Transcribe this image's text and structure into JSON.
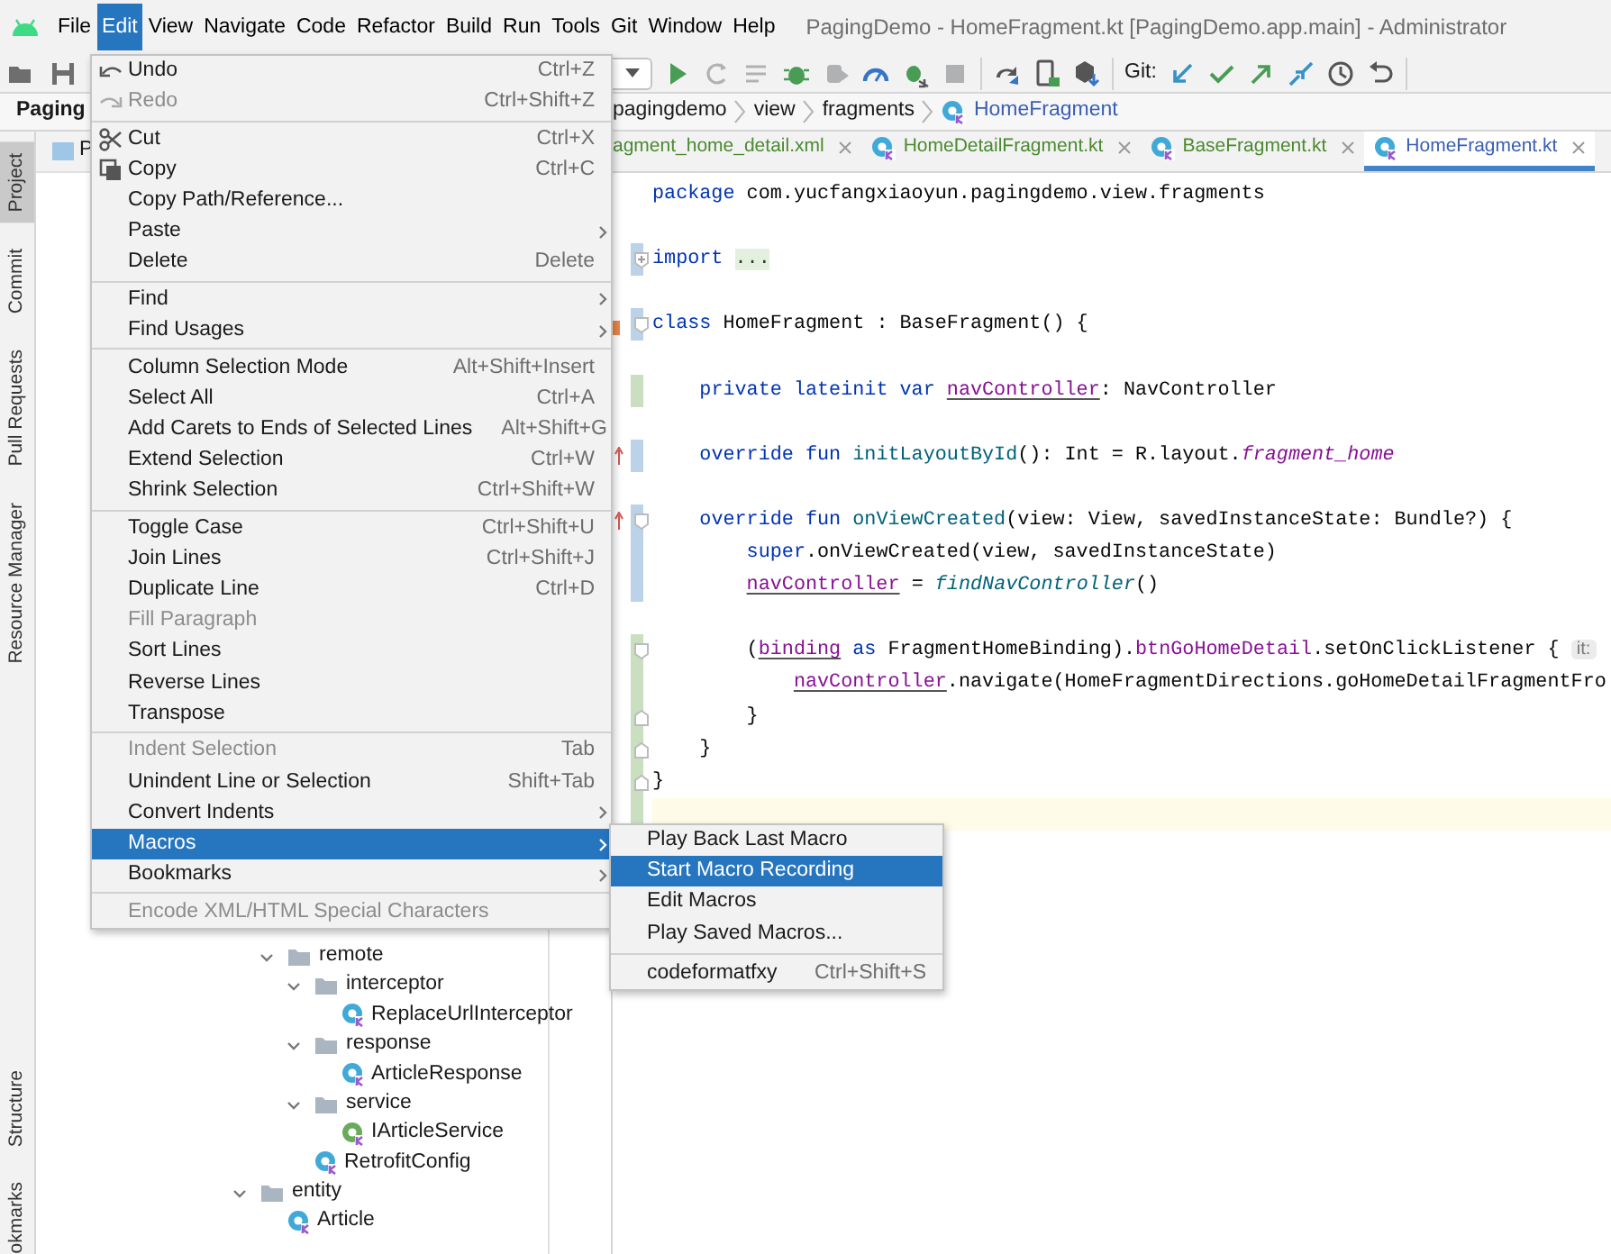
{
  "menubar": {
    "items": [
      {
        "label": "File",
        "selected": false
      },
      {
        "label": "Edit",
        "selected": true
      },
      {
        "label": "View",
        "selected": false
      },
      {
        "label": "Navigate",
        "selected": false
      },
      {
        "label": "Code",
        "selected": false
      },
      {
        "label": "Refactor",
        "selected": false
      },
      {
        "label": "Build",
        "selected": false
      },
      {
        "label": "Run",
        "selected": false
      },
      {
        "label": "Tools",
        "selected": false
      },
      {
        "label": "Git",
        "selected": false
      },
      {
        "label": "Window",
        "selected": false
      },
      {
        "label": "Help",
        "selected": false
      }
    ],
    "window_title": "PagingDemo - HomeFragment.kt [PagingDemo.app.main] - Administrator"
  },
  "toolbar": {
    "git_label": "Git:"
  },
  "breadcrumb": {
    "project": "Paging",
    "items": [
      {
        "label": "pagingdemo",
        "kind": "package"
      },
      {
        "label": "view",
        "kind": "package"
      },
      {
        "label": "fragments",
        "kind": "package"
      },
      {
        "label": "HomeFragment",
        "kind": "class"
      }
    ]
  },
  "tool_stripe": {
    "top": [
      {
        "label": "Project",
        "selected": true
      },
      {
        "label": "Commit",
        "selected": false
      },
      {
        "label": "Pull Requests",
        "selected": false
      },
      {
        "label": "Resource Manager",
        "selected": false
      }
    ],
    "bottom": [
      {
        "label": "Structure",
        "selected": false
      },
      {
        "label": "okmarks",
        "selected": false
      }
    ]
  },
  "project_panel": {
    "header": "P",
    "tree": [
      {
        "children": [
          {
            "label": "remote",
            "kind": "folder",
            "expanded": true,
            "children": [
              {
                "label": "interceptor",
                "kind": "folder",
                "expanded": true,
                "children": [
                  {
                    "label": "ReplaceUrlInterceptor",
                    "kind": "class"
                  }
                ]
              },
              {
                "label": "response",
                "kind": "folder",
                "expanded": true,
                "children": [
                  {
                    "label": "ArticleResponse",
                    "kind": "class"
                  }
                ]
              },
              {
                "label": "service",
                "kind": "folder",
                "expanded": true,
                "children": [
                  {
                    "label": "IArticleService",
                    "kind": "interface"
                  }
                ]
              },
              {
                "label": "RetrofitConfig",
                "kind": "class"
              }
            ]
          }
        ]
      },
      {
        "label": "entity",
        "kind": "folder",
        "expanded": true,
        "children": [
          {
            "label": "Article",
            "kind": "class"
          }
        ]
      }
    ]
  },
  "editor_tabs": [
    {
      "label": "agment_home_detail.xml",
      "modified": false,
      "selected": false
    },
    {
      "label": "HomeDetailFragment.kt",
      "kind": "class",
      "modified": false,
      "selected": false
    },
    {
      "label": "BaseFragment.kt",
      "kind": "class",
      "modified": false,
      "selected": false
    },
    {
      "label": "HomeFragment.kt",
      "kind": "class",
      "modified": true,
      "selected": true
    }
  ],
  "code_lines": [
    {
      "tokens": [
        {
          "kind": "keyword",
          "t": "package"
        },
        {
          "kind": "plain",
          "t": " com.yucfangxiaoyun.pagingdemo.view.fragments"
        }
      ]
    },
    {
      "current": false
    },
    {
      "modified": true,
      "folded": true,
      "tokens": [
        {
          "kind": "keyword",
          "t": "import "
        },
        {
          "kind": "placeholder",
          "t": "..."
        }
      ]
    },
    {
      "current": false
    },
    {
      "modified": true,
      "fold_start": true,
      "implemented": true,
      "tokens": [
        {
          "kind": "keyword",
          "t": "class"
        },
        {
          "kind": "plain",
          "t": " HomeFragment : BaseFragment() {"
        }
      ]
    },
    {
      "current": false
    },
    {
      "added": true,
      "tokens": [
        {
          "kind": "keyword",
          "t": "    private lateinit var "
        },
        {
          "kind": "property",
          "t": "navController"
        },
        {
          "kind": "plain",
          "t": ": NavController"
        }
      ]
    },
    {
      "current": false
    },
    {
      "modified": true,
      "overrides": true,
      "tokens": [
        {
          "kind": "keyword",
          "t": "    override fun "
        },
        {
          "kind": "function",
          "t": "initLayoutById"
        },
        {
          "kind": "plain",
          "t": "(): Int = R.layout."
        },
        {
          "kind": "resource",
          "t": "fragment_home"
        }
      ]
    },
    {
      "current": false
    },
    {
      "modified": true,
      "fold_start": true,
      "overrides": true,
      "tokens": [
        {
          "kind": "keyword",
          "t": "    override fun "
        },
        {
          "kind": "function",
          "t": "onViewCreated"
        },
        {
          "kind": "plain",
          "t": "(view: View, savedInstanceState: Bundle?) {"
        }
      ]
    },
    {
      "modified": true,
      "tokens": [
        {
          "kind": "keyword",
          "t": "        super"
        },
        {
          "kind": "plain",
          "t": ".onViewCreated(view, savedInstanceState)"
        }
      ]
    },
    {
      "modified": true,
      "tokens": [
        {
          "kind": "property",
          "t": "        navController"
        },
        {
          "kind": "plain",
          "t": " = "
        },
        {
          "kind": "extension",
          "t": "findNavController"
        },
        {
          "kind": "plain",
          "t": "()"
        }
      ]
    },
    {
      "current": false
    },
    {
      "added": true,
      "fold_start": true,
      "tokens": [
        {
          "kind": "plain",
          "t": "        ("
        },
        {
          "kind": "property",
          "t": "binding"
        },
        {
          "kind": "keyword",
          "t": " as"
        },
        {
          "kind": "plain",
          "t": " FragmentHomeBinding)."
        },
        {
          "kind": "field",
          "t": "btnGoHomeDetail"
        },
        {
          "kind": "plain",
          "t": ".setOnClickListener { "
        },
        {
          "kind": "hint",
          "t": "it:"
        }
      ]
    },
    {
      "added": true,
      "tokens": [
        {
          "kind": "property",
          "t": "            navController"
        },
        {
          "kind": "plain",
          "t": ".navigate(HomeFragmentDirections.goHomeDetailFragmentFro"
        }
      ]
    },
    {
      "added": true,
      "fold_end": true,
      "tokens": [
        {
          "kind": "plain",
          "t": "        }"
        }
      ]
    },
    {
      "added": true,
      "fold_end": true,
      "tokens": [
        {
          "kind": "plain",
          "t": "    }"
        }
      ]
    },
    {
      "added": true,
      "fold_end": true,
      "tokens": [
        {
          "kind": "plain",
          "t": "}"
        }
      ]
    },
    {
      "added": true,
      "current": true
    }
  ],
  "edit_menu": {
    "items": [
      {
        "kind": "undo",
        "label": "Undo",
        "shortcut": "Ctrl+Z",
        "disabled": false,
        "selected": false
      },
      {
        "kind": "redo",
        "label": "Redo",
        "shortcut": "Ctrl+Shift+Z",
        "disabled": true,
        "selected": false
      },
      {
        "kind": "cut",
        "separator_before": true,
        "label": "Cut",
        "shortcut": "Ctrl+X",
        "disabled": false,
        "selected": false
      },
      {
        "kind": "copy",
        "label": "Copy",
        "shortcut": "Ctrl+C",
        "disabled": false,
        "selected": false
      },
      {
        "kind": "text",
        "label": "Copy Path/Reference...",
        "disabled": false,
        "selected": false
      },
      {
        "kind": "text",
        "label": "Paste",
        "submenu": true,
        "disabled": false,
        "selected": false
      },
      {
        "kind": "text",
        "label": "Delete",
        "shortcut": "Delete",
        "disabled": false,
        "selected": false
      },
      {
        "kind": "text",
        "separator_before": true,
        "label": "Find",
        "submenu": true,
        "disabled": false,
        "selected": false
      },
      {
        "kind": "text",
        "label": "Find Usages",
        "submenu": true,
        "disabled": false,
        "selected": false
      },
      {
        "kind": "text",
        "separator_before": true,
        "label": "Column Selection Mode",
        "shortcut": "Alt+Shift+Insert",
        "disabled": false,
        "selected": false
      },
      {
        "kind": "text",
        "label": "Select All",
        "shortcut": "Ctrl+A",
        "disabled": false,
        "selected": false
      },
      {
        "kind": "text",
        "label": "Add Carets to Ends of Selected Lines",
        "shortcut": "Alt+Shift+G",
        "disabled": false,
        "selected": false
      },
      {
        "kind": "text",
        "label": "Extend Selection",
        "shortcut": "Ctrl+W",
        "disabled": false,
        "selected": false
      },
      {
        "kind": "text",
        "label": "Shrink Selection",
        "shortcut": "Ctrl+Shift+W",
        "disabled": false,
        "selected": false
      },
      {
        "kind": "text",
        "separator_before": true,
        "label": "Toggle Case",
        "shortcut": "Ctrl+Shift+U",
        "disabled": false,
        "selected": false
      },
      {
        "kind": "text",
        "label": "Join Lines",
        "shortcut": "Ctrl+Shift+J",
        "disabled": false,
        "selected": false
      },
      {
        "kind": "text",
        "label": "Duplicate Line",
        "shortcut": "Ctrl+D",
        "disabled": false,
        "selected": false
      },
      {
        "kind": "text",
        "label": "Fill Paragraph",
        "disabled": true,
        "selected": false
      },
      {
        "kind": "text",
        "label": "Sort Lines",
        "disabled": false,
        "selected": false
      },
      {
        "kind": "text",
        "label": "Reverse Lines",
        "disabled": false,
        "selected": false
      },
      {
        "kind": "text",
        "label": "Transpose",
        "disabled": false,
        "selected": false
      },
      {
        "kind": "text",
        "separator_before": true,
        "label": "Indent Selection",
        "shortcut": "Tab",
        "disabled": true,
        "selected": false
      },
      {
        "kind": "text",
        "label": "Unindent Line or Selection",
        "shortcut": "Shift+Tab",
        "disabled": false,
        "selected": false
      },
      {
        "kind": "text",
        "label": "Convert Indents",
        "submenu": true,
        "disabled": false,
        "selected": false
      },
      {
        "kind": "text",
        "label": "Macros",
        "submenu": true,
        "disabled": false,
        "selected": true
      },
      {
        "kind": "text",
        "label": "Bookmarks",
        "submenu": true,
        "disabled": false,
        "selected": false
      },
      {
        "kind": "text",
        "separator_before": true,
        "label": "Encode XML/HTML Special Characters",
        "disabled": true,
        "selected": false
      }
    ]
  },
  "macros_submenu": {
    "items": [
      {
        "label": "Play Back Last Macro",
        "disabled": false,
        "selected": false
      },
      {
        "label": "Start Macro Recording",
        "disabled": false,
        "selected": true
      },
      {
        "label": "Edit Macros",
        "disabled": false,
        "selected": false
      },
      {
        "label": "Play Saved Macros...",
        "disabled": false,
        "selected": false
      },
      {
        "separator_before": true,
        "label": "codeformatfxy",
        "shortcut": "Ctrl+Shift+S",
        "disabled": false,
        "selected": false
      }
    ]
  }
}
